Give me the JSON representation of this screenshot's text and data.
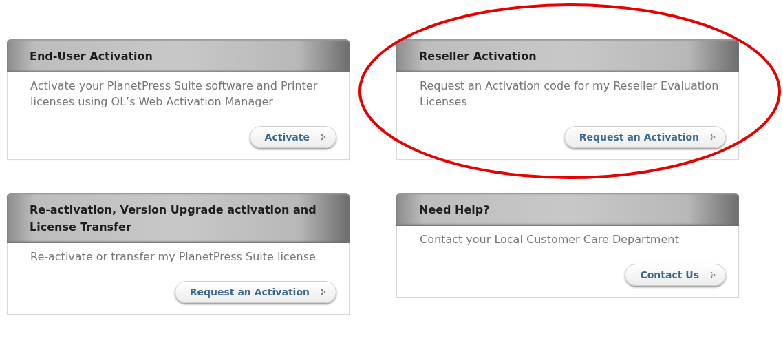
{
  "cards": [
    {
      "title": "End-User Activation",
      "description": "Activate your PlanetPress Suite software and Printer licenses using OL’s Web Activation Manager",
      "button": "Activate",
      "highlighted": false
    },
    {
      "title": "Reseller Activation",
      "description": "Request an Activation code for my Reseller Evaluation Licenses",
      "button": "Request an Activation",
      "highlighted": true
    },
    {
      "title": "Re-activation, Version Upgrade activation and License Transfer",
      "description": "Re-activate or transfer my PlanetPress Suite license",
      "button": "Request an Activation",
      "highlighted": false
    },
    {
      "title": "Need Help?",
      "description": "Contact your Local Customer Care Department",
      "button": "Contact Us",
      "highlighted": false
    }
  ]
}
